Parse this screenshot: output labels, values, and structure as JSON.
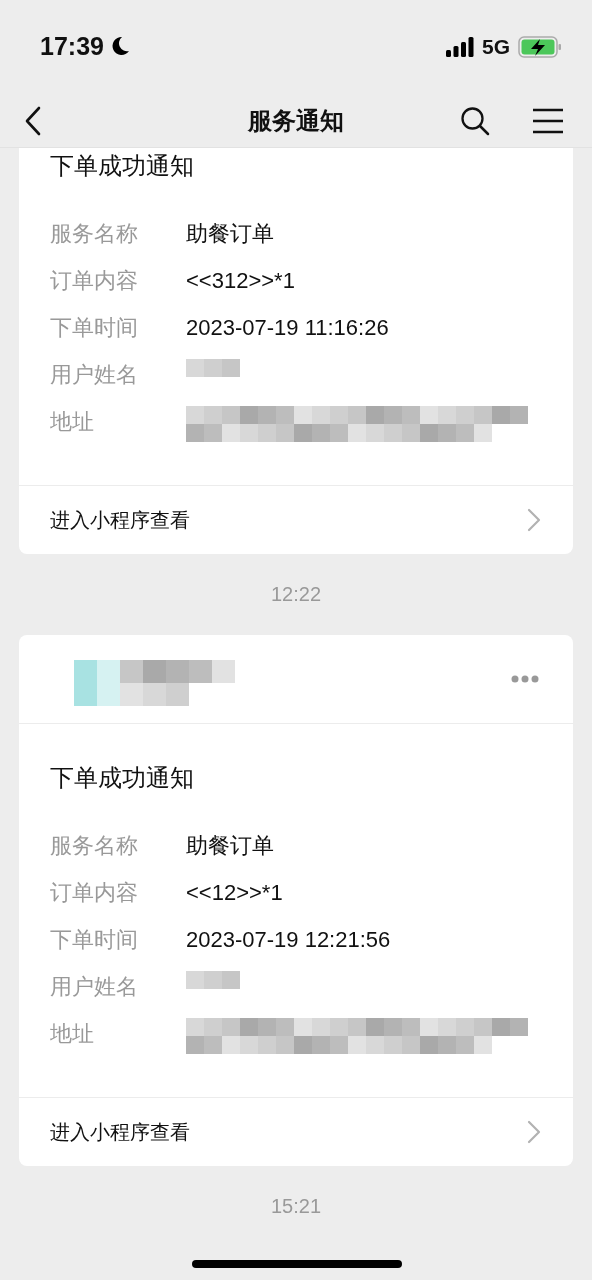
{
  "status_bar": {
    "time": "17:39",
    "network": "5G"
  },
  "nav": {
    "title": "服务通知"
  },
  "messages": [
    {
      "title": "下单成功通知",
      "fields": [
        {
          "kind": "text",
          "label": "服务名称",
          "value": "助餐订单"
        },
        {
          "kind": "text",
          "label": "订单内容",
          "value": "<<312>>*1"
        },
        {
          "kind": "text",
          "label": "下单时间",
          "value": "2023-07-19 11:16:26"
        },
        {
          "kind": "mosaic",
          "label": "用户姓名"
        },
        {
          "kind": "mosaic_long",
          "label": "地址"
        }
      ],
      "link": "进入小程序查看"
    },
    {
      "time": "12:22",
      "sender": {
        "kind": "mosaic"
      },
      "title": "下单成功通知",
      "fields": [
        {
          "kind": "text",
          "label": "服务名称",
          "value": "助餐订单"
        },
        {
          "kind": "text",
          "label": "订单内容",
          "value": "<<12>>*1"
        },
        {
          "kind": "text",
          "label": "下单时间",
          "value": "2023-07-19 12:21:56"
        },
        {
          "kind": "mosaic",
          "label": "用户姓名"
        },
        {
          "kind": "mosaic_long",
          "label": "地址"
        }
      ],
      "link": "进入小程序查看"
    },
    {
      "time": "15:21"
    }
  ]
}
